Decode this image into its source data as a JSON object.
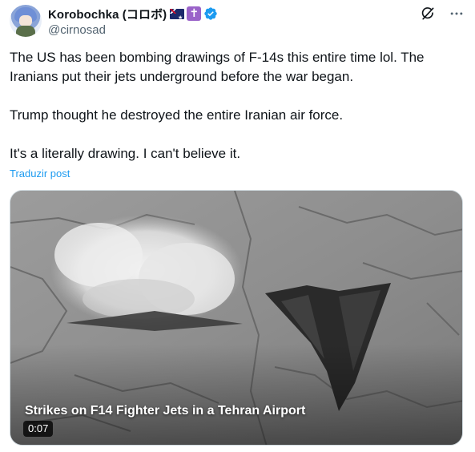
{
  "author": {
    "display_name": "Korobochka (コロボ)",
    "handle": "@cirnosad",
    "badges": [
      "australia-flag",
      "latin-cross",
      "verified-badge"
    ],
    "cross_glyph": "✝"
  },
  "tweet": {
    "paragraphs": [
      "The US has been bombing drawings of F-14s this entire time lol. The Iranians put their jets underground before the war began.",
      "Trump thought he destroyed the entire Iranian air force.",
      "It's a literally drawing. I can't believe it."
    ],
    "translate_label": "Traduzir post"
  },
  "media": {
    "title": "Strikes on F14 Fighter Jets in a Tehran Airport",
    "duration": "0:07"
  },
  "header_icons": [
    "grok-icon",
    "more-icon"
  ],
  "colors": {
    "link": "#1d9bf0",
    "verified": "#1d9bf0",
    "secondary_text": "#536471",
    "primary_text": "#0f1419"
  }
}
